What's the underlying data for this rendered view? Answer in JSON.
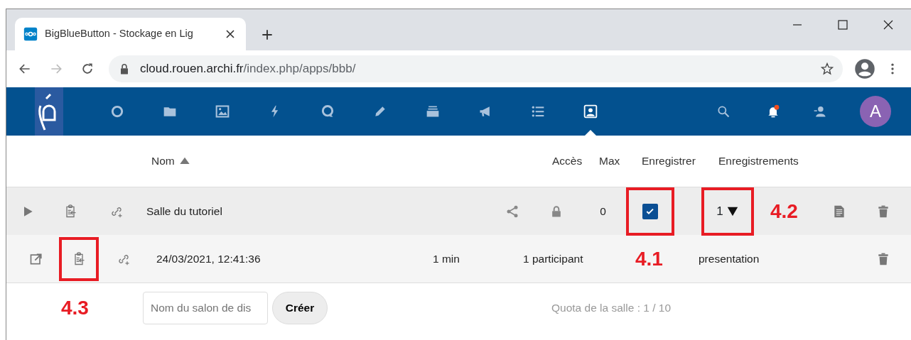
{
  "browser": {
    "tab_title": "BigBlueButton - Stockage en Lig",
    "url_host": "cloud.rouen.archi.fr",
    "url_path": "/index.php/apps/bbb/"
  },
  "app_nav": {
    "items": [
      {
        "kind": "circle",
        "selected": false
      },
      {
        "kind": "folder",
        "selected": false
      },
      {
        "kind": "image",
        "selected": false
      },
      {
        "kind": "bolt",
        "selected": false
      },
      {
        "kind": "chat",
        "selected": false
      },
      {
        "kind": "pencil",
        "selected": false
      },
      {
        "kind": "deck",
        "selected": false
      },
      {
        "kind": "megaphone",
        "selected": false
      },
      {
        "kind": "list",
        "selected": false
      },
      {
        "kind": "contact",
        "selected": true
      }
    ],
    "notification": true,
    "avatar_letter": "A"
  },
  "table": {
    "sort_column": {
      "label": "Nom",
      "ascending": true
    },
    "columns": [
      "Accès",
      "Max",
      "Enregistrer",
      "Enregistrements"
    ],
    "room": {
      "name": "Salle du tutoriel",
      "max": "0",
      "record": true,
      "record_highlighted": true,
      "recordings_count": "1",
      "expanded": true,
      "recordings_highlighted": true
    },
    "recording": {
      "date": "24/03/2021, 12:41:36",
      "duration": "1 min",
      "participants": "1 participant",
      "type": "presentation",
      "clipboard_highlighted": true
    }
  },
  "annotations": {
    "record_checkbox": "4.1",
    "recordings_toggle": "4.2",
    "recording_clipboard": "4.3"
  },
  "footer": {
    "placeholder": "Nom du salon de dis",
    "create_button": "Créer",
    "quota": "Quota de la salle : 1 / 10"
  }
}
